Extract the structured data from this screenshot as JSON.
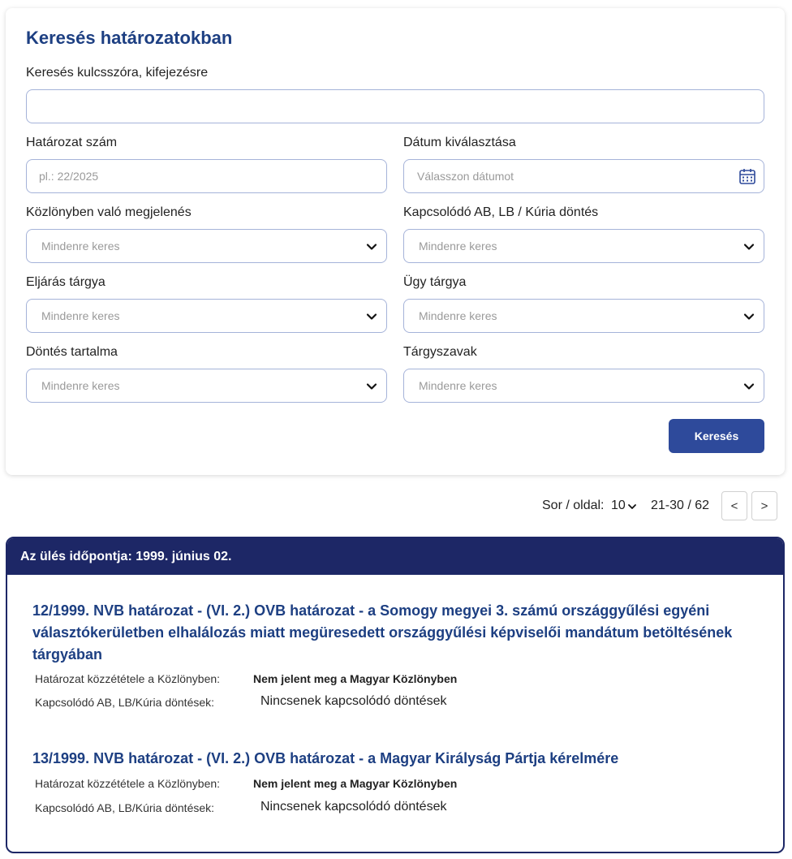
{
  "search": {
    "title": "Keresés határozatokban",
    "keyword_label": "Keresés kulcsszóra, kifejezésre",
    "keyword_value": "",
    "number_label": "Határozat szám",
    "number_placeholder": "pl.: 22/2025",
    "date_label": "Dátum kiválasztása",
    "date_placeholder": "Válasszon dátumot",
    "gazette_label": "Közlönyben való megjelenés",
    "gazette_value": "Mindenre keres",
    "related_label": "Kapcsolódó AB, LB / Kúria döntés",
    "related_value": "Mindenre keres",
    "procedure_label": "Eljárás tárgya",
    "procedure_value": "Mindenre keres",
    "case_label": "Ügy tárgya",
    "case_value": "Mindenre keres",
    "decision_label": "Döntés tartalma",
    "decision_value": "Mindenre keres",
    "keywords_label": "Tárgyszavak",
    "keywords_value": "Mindenre keres",
    "submit_label": "Keresés"
  },
  "pager": {
    "rows_label": "Sor / oldal:",
    "rows_value": "10",
    "range": "21-30 / 62",
    "prev": "<",
    "next": ">"
  },
  "session": {
    "header": "Az ülés időpontja: 1999. június 02.",
    "items": [
      {
        "title": "12/1999. NVB határozat - (VI. 2.) OVB határozat - a Somogy megyei 3. számú országgyűlési egyéni választókerületben elhalálozás miatt megüresedett országgyűlési képviselői mandátum betöltésének tárgyában",
        "gazette_label": "Határozat közzététele a Közlönyben:",
        "gazette_value": "Nem jelent meg a Magyar Közlönyben",
        "related_label": "Kapcsolódó AB, LB/Kúria döntések:",
        "related_value": "Nincsenek kapcsolódó döntések"
      },
      {
        "title": "13/1999. NVB határozat - (VI. 2.) OVB határozat - a Magyar Királyság Pártja kérelmére",
        "gazette_label": "Határozat közzététele a Közlönyben:",
        "gazette_value": "Nem jelent meg a Magyar Közlönyben",
        "related_label": "Kapcsolódó AB, LB/Kúria döntések:",
        "related_value": "Nincsenek kapcsolódó döntések"
      }
    ]
  },
  "colors": {
    "title_blue": "#1d3f82",
    "header_navy": "#1d2766",
    "button_blue": "#2e4a9b",
    "field_border": "#a5b3d9"
  },
  "icons": {
    "date": "calendar-icon",
    "select": "chevron-down-icon"
  }
}
